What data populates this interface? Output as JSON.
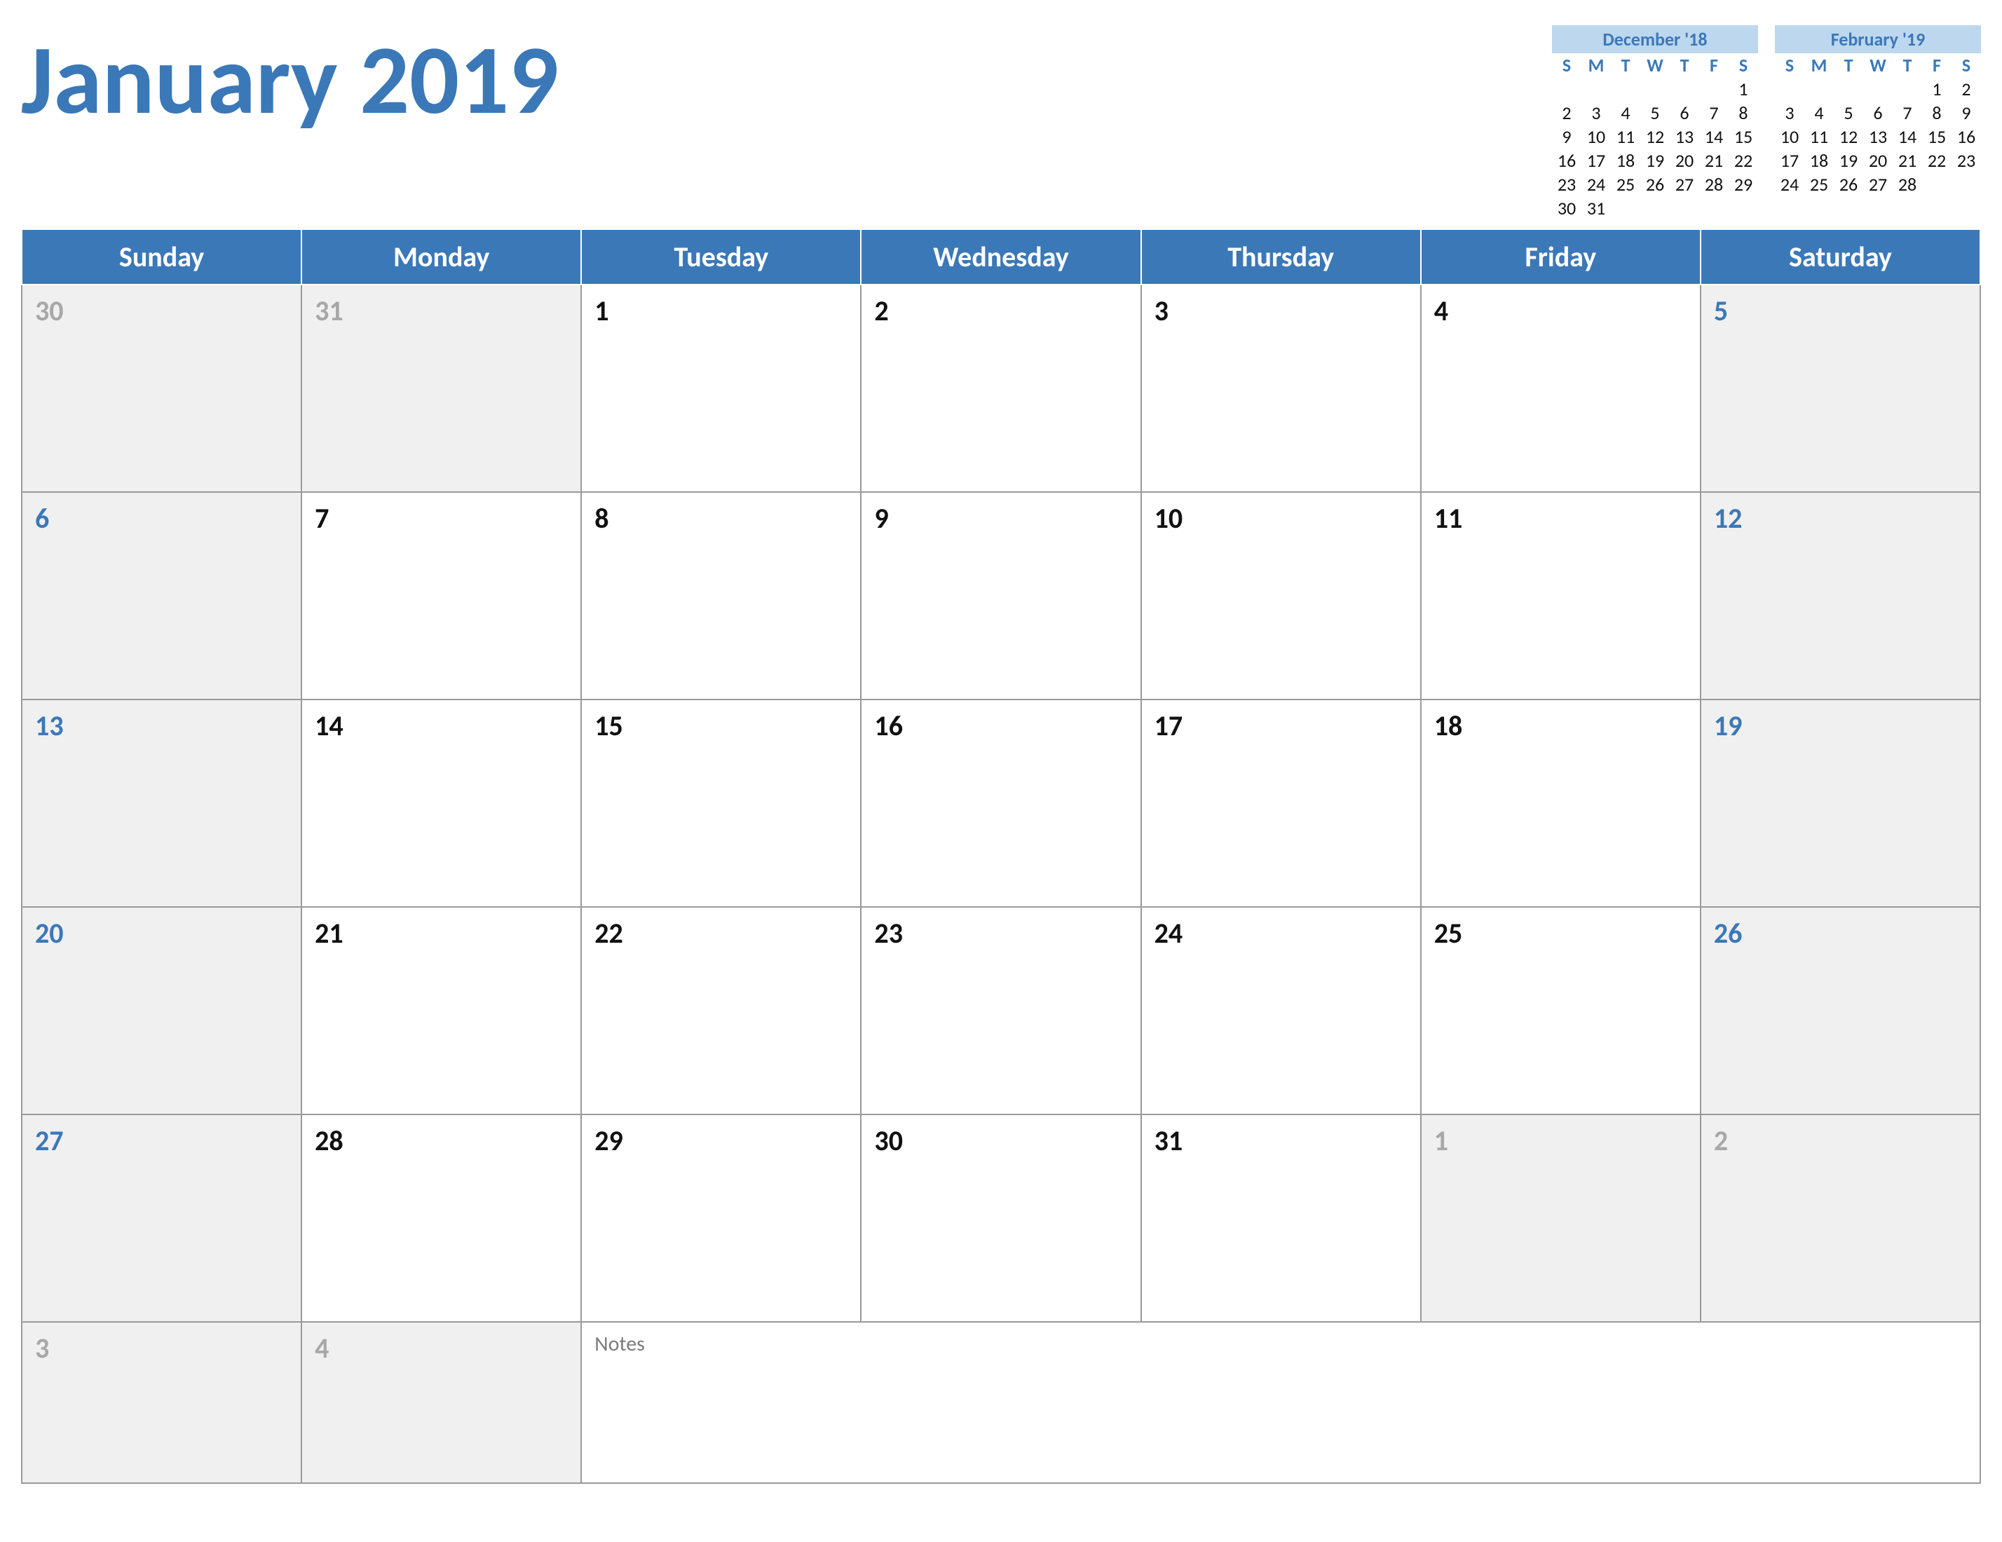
{
  "title": "January 2019",
  "day_headers": [
    "Sunday",
    "Monday",
    "Tuesday",
    "Wednesday",
    "Thursday",
    "Friday",
    "Saturday"
  ],
  "mini_headers": [
    "S",
    "M",
    "T",
    "W",
    "T",
    "F",
    "S"
  ],
  "notes_label": "Notes",
  "mini_calendars": [
    {
      "title": "December '18",
      "weeks": [
        [
          "",
          "",
          "",
          "",
          "",
          "",
          "1"
        ],
        [
          "2",
          "3",
          "4",
          "5",
          "6",
          "7",
          "8"
        ],
        [
          "9",
          "10",
          "11",
          "12",
          "13",
          "14",
          "15"
        ],
        [
          "16",
          "17",
          "18",
          "19",
          "20",
          "21",
          "22"
        ],
        [
          "23",
          "24",
          "25",
          "26",
          "27",
          "28",
          "29"
        ],
        [
          "30",
          "31",
          "",
          "",
          "",
          "",
          ""
        ]
      ]
    },
    {
      "title": "February '19",
      "weeks": [
        [
          "",
          "",
          "",
          "",
          "",
          "1",
          "2"
        ],
        [
          "3",
          "4",
          "5",
          "6",
          "7",
          "8",
          "9"
        ],
        [
          "10",
          "11",
          "12",
          "13",
          "14",
          "15",
          "16"
        ],
        [
          "17",
          "18",
          "19",
          "20",
          "21",
          "22",
          "23"
        ],
        [
          "24",
          "25",
          "26",
          "27",
          "28",
          "",
          ""
        ]
      ]
    }
  ],
  "weeks": [
    [
      {
        "n": "30",
        "adjacent": true,
        "weekend": true
      },
      {
        "n": "31",
        "adjacent": true
      },
      {
        "n": "1"
      },
      {
        "n": "2"
      },
      {
        "n": "3"
      },
      {
        "n": "4"
      },
      {
        "n": "5",
        "weekend": true
      }
    ],
    [
      {
        "n": "6",
        "weekend": true
      },
      {
        "n": "7"
      },
      {
        "n": "8"
      },
      {
        "n": "9"
      },
      {
        "n": "10"
      },
      {
        "n": "11"
      },
      {
        "n": "12",
        "weekend": true
      }
    ],
    [
      {
        "n": "13",
        "weekend": true
      },
      {
        "n": "14"
      },
      {
        "n": "15"
      },
      {
        "n": "16"
      },
      {
        "n": "17"
      },
      {
        "n": "18"
      },
      {
        "n": "19",
        "weekend": true
      }
    ],
    [
      {
        "n": "20",
        "weekend": true
      },
      {
        "n": "21"
      },
      {
        "n": "22"
      },
      {
        "n": "23"
      },
      {
        "n": "24"
      },
      {
        "n": "25"
      },
      {
        "n": "26",
        "weekend": true
      }
    ],
    [
      {
        "n": "27",
        "weekend": true
      },
      {
        "n": "28"
      },
      {
        "n": "29"
      },
      {
        "n": "30"
      },
      {
        "n": "31"
      },
      {
        "n": "1",
        "adjacent": true
      },
      {
        "n": "2",
        "adjacent": true,
        "weekend": true
      }
    ],
    [
      {
        "n": "3",
        "adjacent": true,
        "weekend": true
      },
      {
        "n": "4",
        "adjacent": true
      },
      {
        "notes": true
      }
    ]
  ]
}
